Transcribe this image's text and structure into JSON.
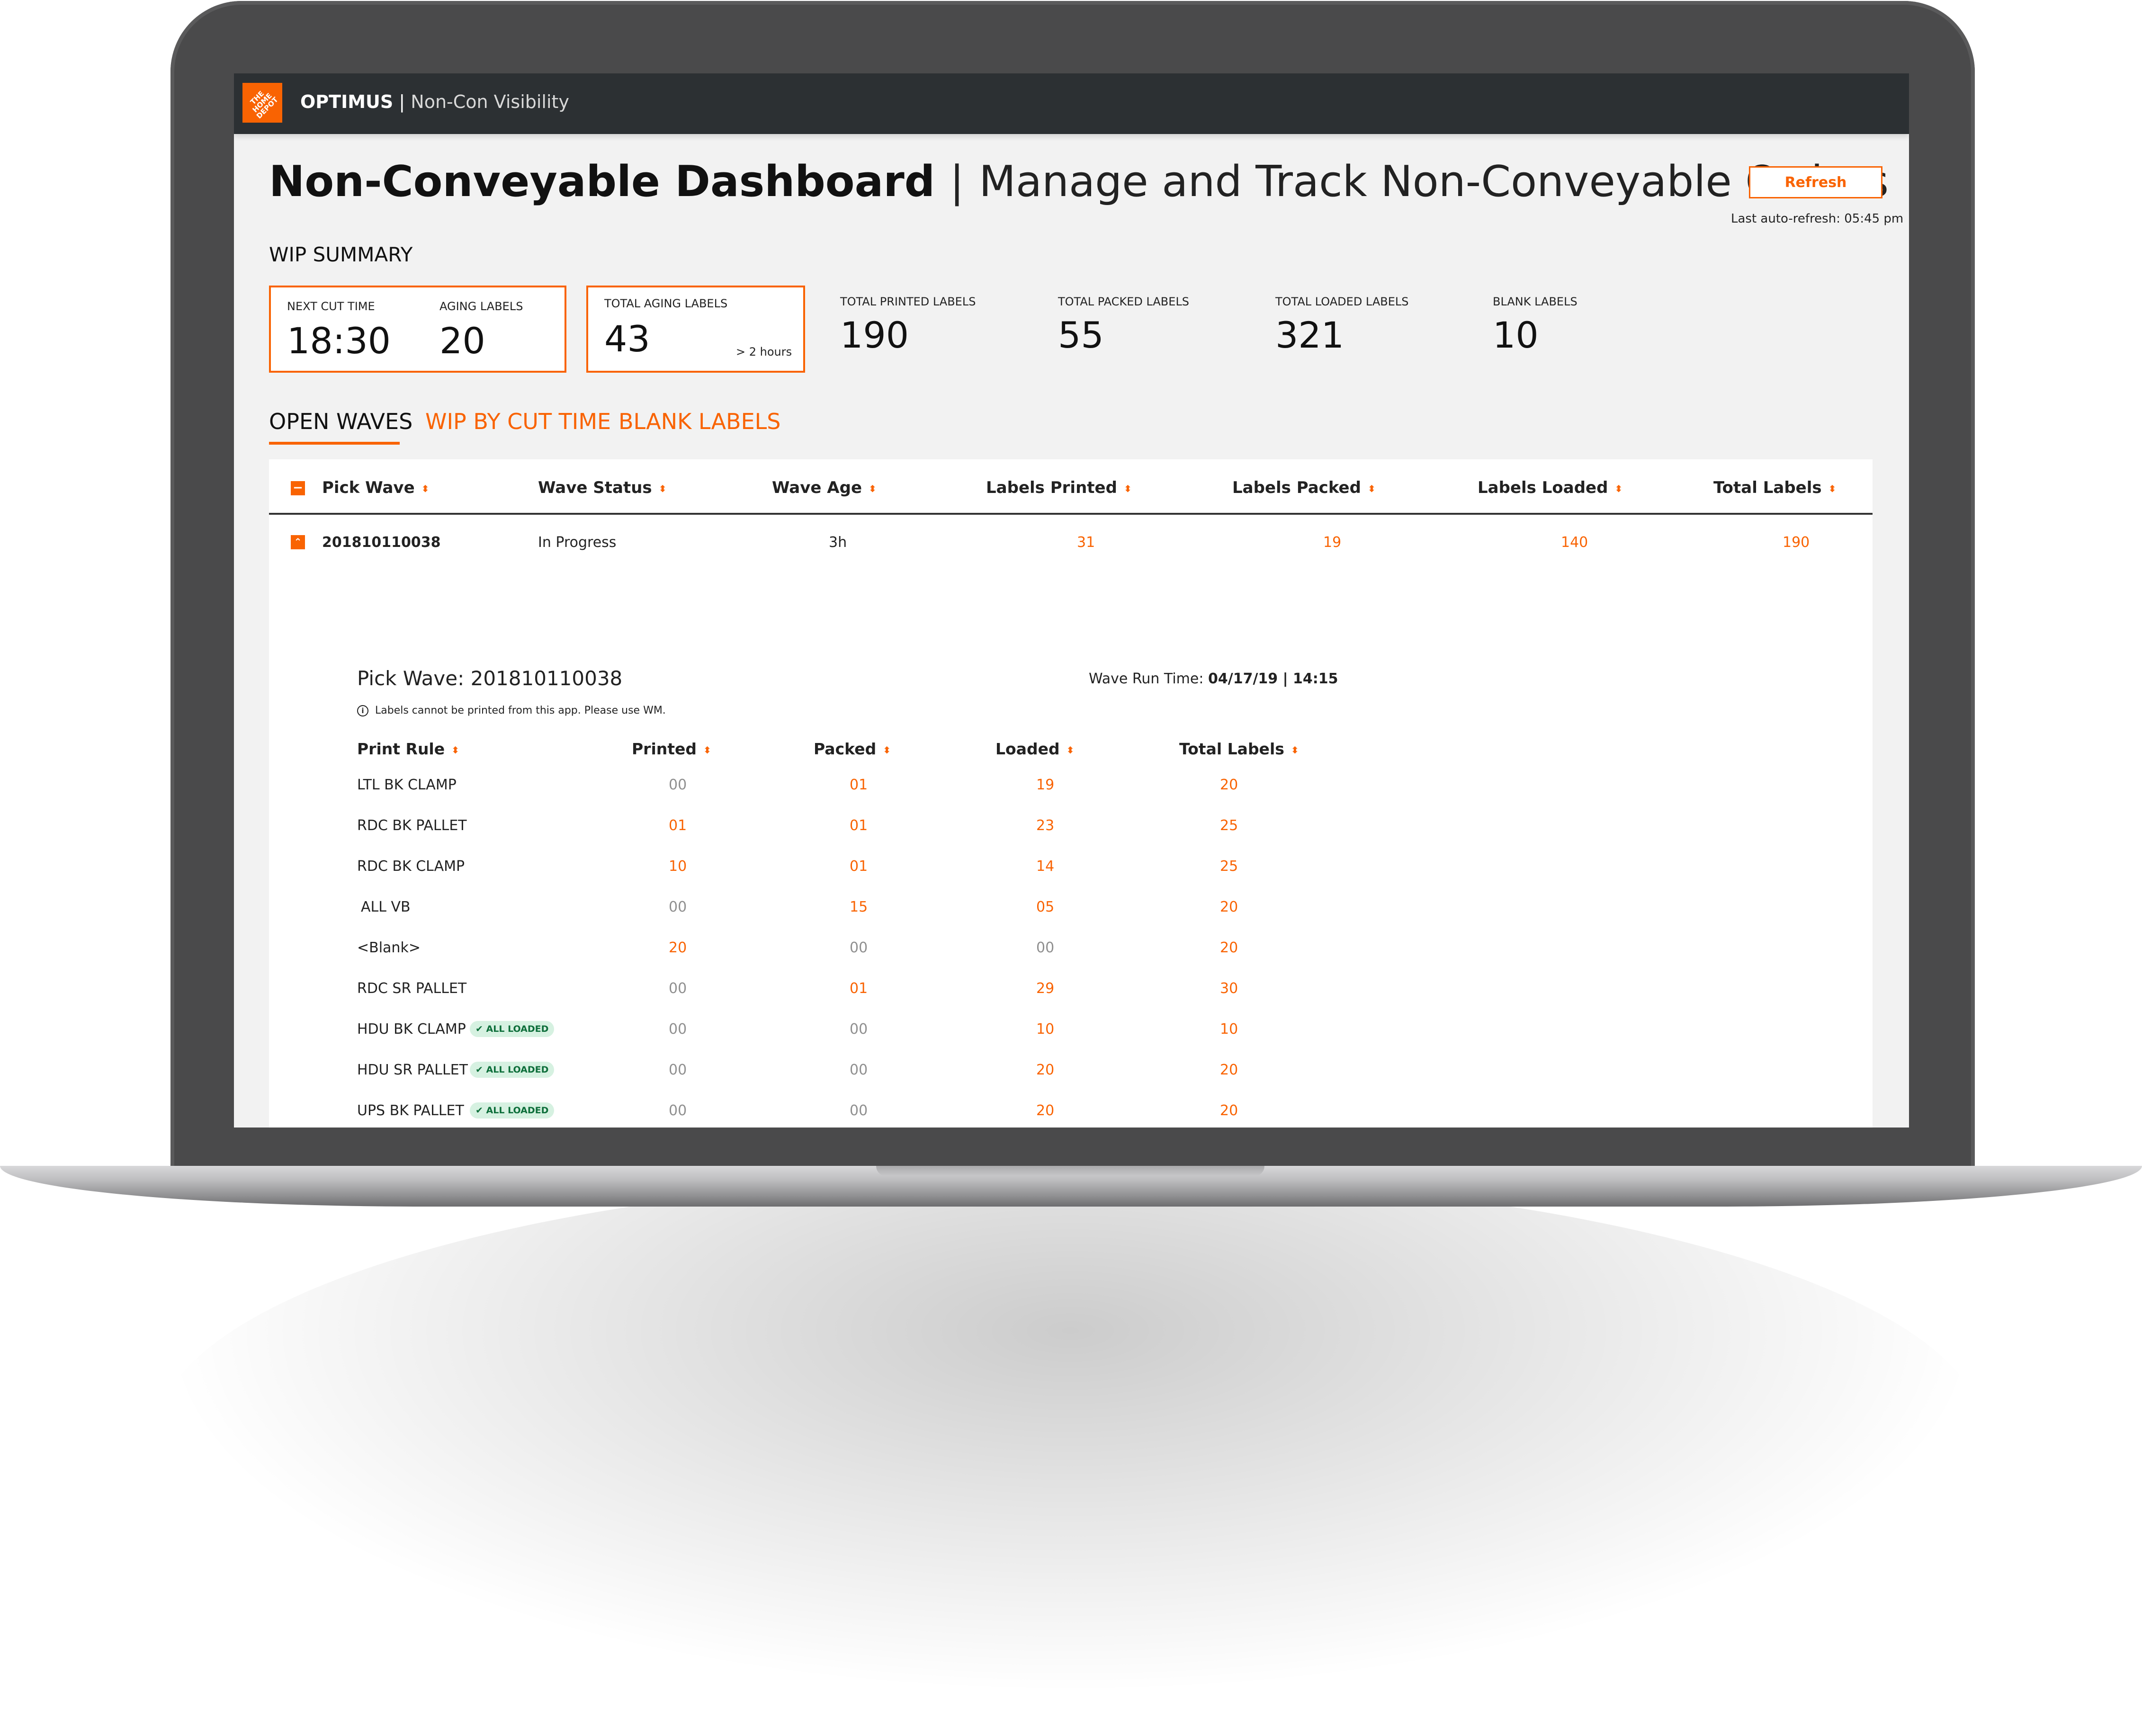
{
  "header": {
    "logo_text": "THE HOME DEPOT",
    "app_name": "OPTIMUS",
    "separator": "|",
    "module": "Non-Con Visibility"
  },
  "page": {
    "title": "Non-Conveyable Dashboard",
    "separator": "|",
    "subtitle": "Manage and Track Non-Conveyable Orders",
    "refresh_label": "Refresh",
    "last_refresh": "Last auto-refresh: 05:45 pm"
  },
  "wip": {
    "title": "WIP SUMMARY",
    "next_cut_label": "NEXT CUT TIME",
    "next_cut_value": "18:30",
    "aging_label": "AGING LABELS",
    "aging_value": "20",
    "total_aging_label": "TOTAL AGING LABELS",
    "total_aging_value": "43",
    "total_aging_note": "> 2 hours",
    "stats": [
      {
        "label": "TOTAL PRINTED LABELS",
        "value": "190"
      },
      {
        "label": "TOTAL PACKED LABELS",
        "value": "55"
      },
      {
        "label": "TOTAL LOADED LABELS",
        "value": "321"
      },
      {
        "label": "BLANK LABELS",
        "value": "10"
      }
    ]
  },
  "tabs": [
    "OPEN WAVES",
    "WIP BY CUT TIME",
    "BLANK LABELS"
  ],
  "table": {
    "headers": [
      "Pick Wave",
      "Wave Status",
      "Wave Age",
      "Labels Printed",
      "Labels Packed",
      "Labels Loaded",
      "Total Labels"
    ],
    "row": {
      "pick_wave": "201810110038",
      "status": "In Progress",
      "age": "3h",
      "printed": "31",
      "packed": "19",
      "loaded": "140",
      "total": "190"
    }
  },
  "detail": {
    "title": "Pick Wave: 201810110038",
    "runtime_label": "Wave Run Time: ",
    "runtime_value": "04/17/19 | 14:15",
    "notice": "Labels cannot be printed from this app. Please use WM.",
    "headers": [
      "Print Rule",
      "Printed",
      "Packed",
      "Loaded",
      "Total Labels"
    ],
    "badge_label": "ALL LOADED",
    "rows": [
      {
        "rule": "LTL BK CLAMP",
        "printed": "00",
        "packed": "01",
        "loaded": "19",
        "total": "20"
      },
      {
        "rule": "RDC BK PALLET",
        "printed": "01",
        "packed": "01",
        "loaded": "23",
        "total": "25"
      },
      {
        "rule": "RDC BK CLAMP",
        "printed": "10",
        "packed": "01",
        "loaded": "14",
        "total": "25"
      },
      {
        "rule": "ALL VB",
        "printed": "00",
        "packed": "15",
        "loaded": "05",
        "total": "20"
      },
      {
        "rule": "<Blank>",
        "printed": "20",
        "packed": "00",
        "loaded": "00",
        "total": "20"
      },
      {
        "rule": "RDC SR PALLET",
        "printed": "00",
        "packed": "01",
        "loaded": "29",
        "total": "30"
      },
      {
        "rule": "HDU BK CLAMP",
        "printed": "00",
        "packed": "00",
        "loaded": "10",
        "total": "10"
      },
      {
        "rule": "HDU SR PALLET",
        "printed": "00",
        "packed": "00",
        "loaded": "20",
        "total": "20"
      },
      {
        "rule": "UPS BK PALLET",
        "printed": "00",
        "packed": "00",
        "loaded": "20",
        "total": "20"
      }
    ]
  },
  "colors": {
    "accent": "#f96302",
    "topbar": "#2c3033",
    "badge_bg": "#d6f1e1",
    "badge_text": "#0d6e3a"
  }
}
